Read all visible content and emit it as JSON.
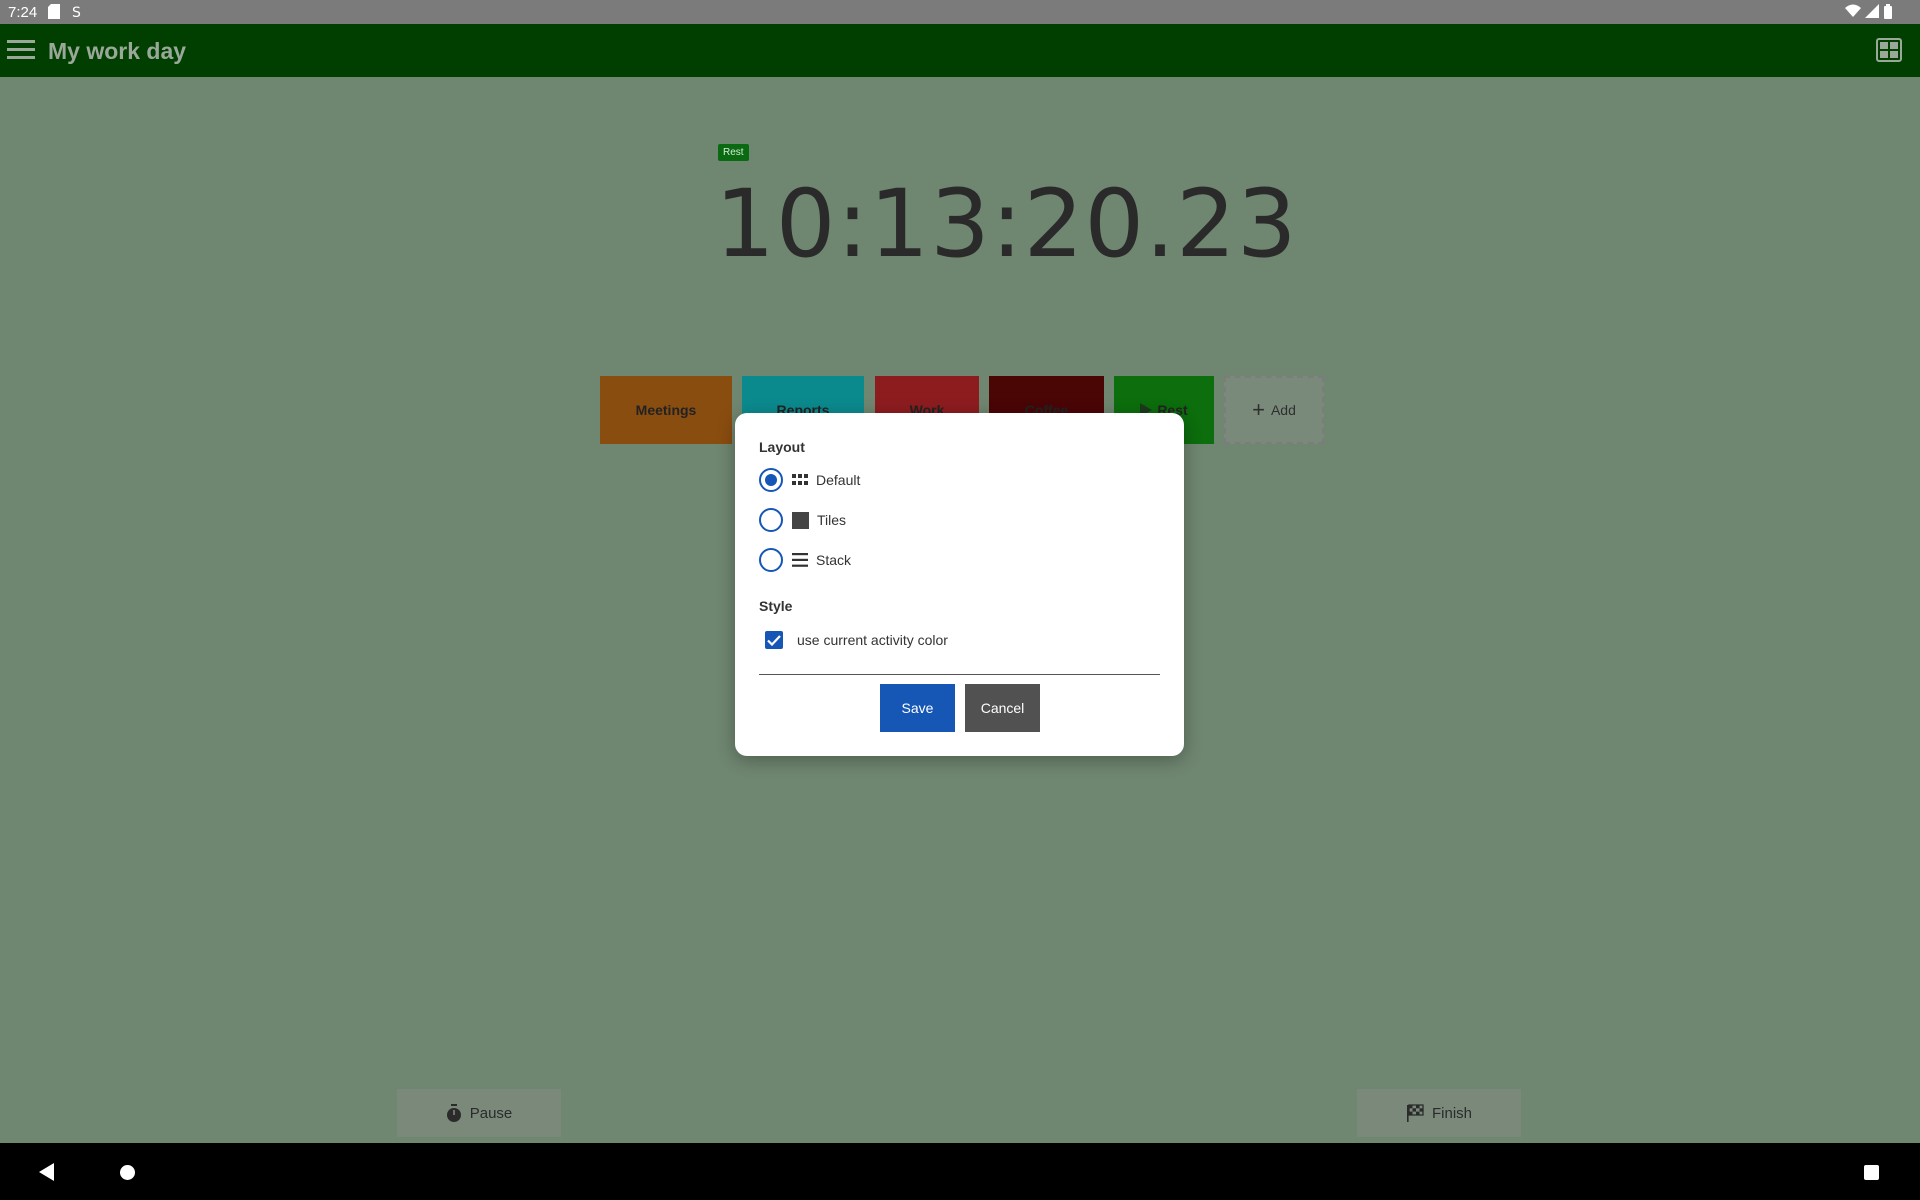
{
  "status_bar": {
    "time": "7:24"
  },
  "app_bar": {
    "title": "My work day"
  },
  "current": {
    "activity_badge": "Rest",
    "elapsed": "10:13:20.23"
  },
  "activities": [
    {
      "label": "Meetings",
      "color": "#8a4d10"
    },
    {
      "label": "Reports",
      "color": "#0b8a8e"
    },
    {
      "label": "Work",
      "color": "#8d1c1f"
    },
    {
      "label": "Coffee",
      "color": "#4a0505"
    },
    {
      "label": "Rest",
      "color": "#0c6e0c"
    },
    {
      "label": "Add"
    }
  ],
  "controls": {
    "pause": "Pause",
    "finish": "Finish"
  },
  "dialog": {
    "layout_title": "Layout",
    "layout_options": [
      {
        "label": "Default",
        "icon": "grid-icon",
        "selected": true
      },
      {
        "label": "Tiles",
        "icon": "square-icon",
        "selected": false
      },
      {
        "label": "Stack",
        "icon": "list-icon",
        "selected": false
      }
    ],
    "style_title": "Style",
    "use_activity_color_label": "use current activity color",
    "use_activity_color_checked": true,
    "save": "Save",
    "cancel": "Cancel"
  }
}
